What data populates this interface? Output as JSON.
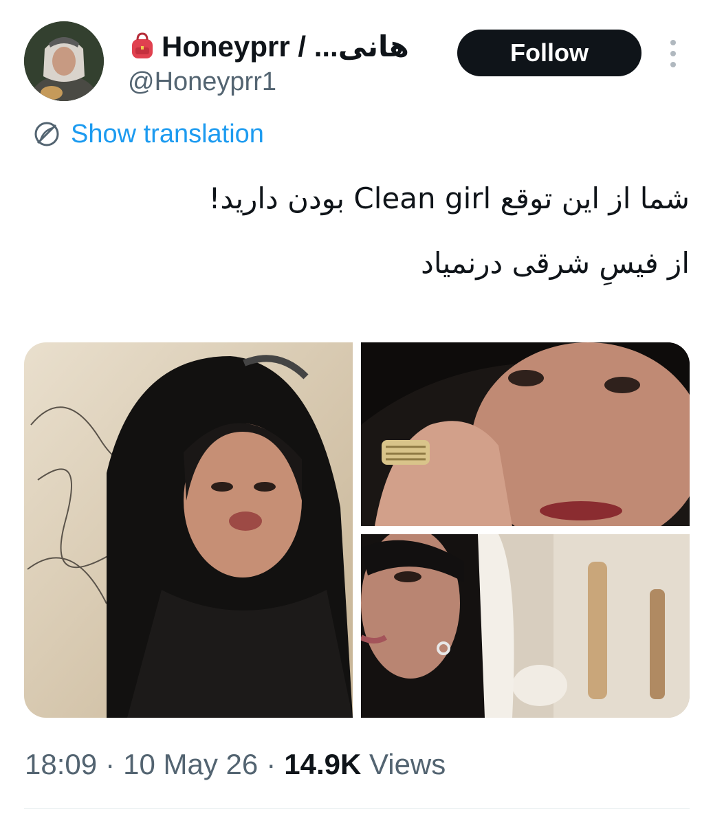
{
  "author": {
    "display_name": "Honeyprr / ...هانی",
    "name_emoji_icon": "backpack-icon",
    "handle": "@Honeyprr1",
    "avatar_icon": "profile-photo"
  },
  "actions": {
    "follow_label": "Follow",
    "more_icon": "more-options-icon"
  },
  "translation": {
    "icon": "translate-globe-icon",
    "label": "Show translation"
  },
  "tweet": {
    "lines": [
      "شما از این توقع Clean girl بودن دارید!",
      "از فیسِ شرقی درنمیاد"
    ]
  },
  "media": {
    "count": 3,
    "photos": [
      "portrait-veil-photo",
      "ring-closeup-photo",
      "earring-profile-photo"
    ]
  },
  "meta": {
    "time": "18:09",
    "separator": "·",
    "date": "10 May 26",
    "views_count": "14.9K",
    "views_label": "Views"
  },
  "colors": {
    "text": "#0f1419",
    "secondary": "#536471",
    "link": "#1d9bf0",
    "follow_bg": "#0f1419",
    "follow_text": "#ffffff"
  }
}
